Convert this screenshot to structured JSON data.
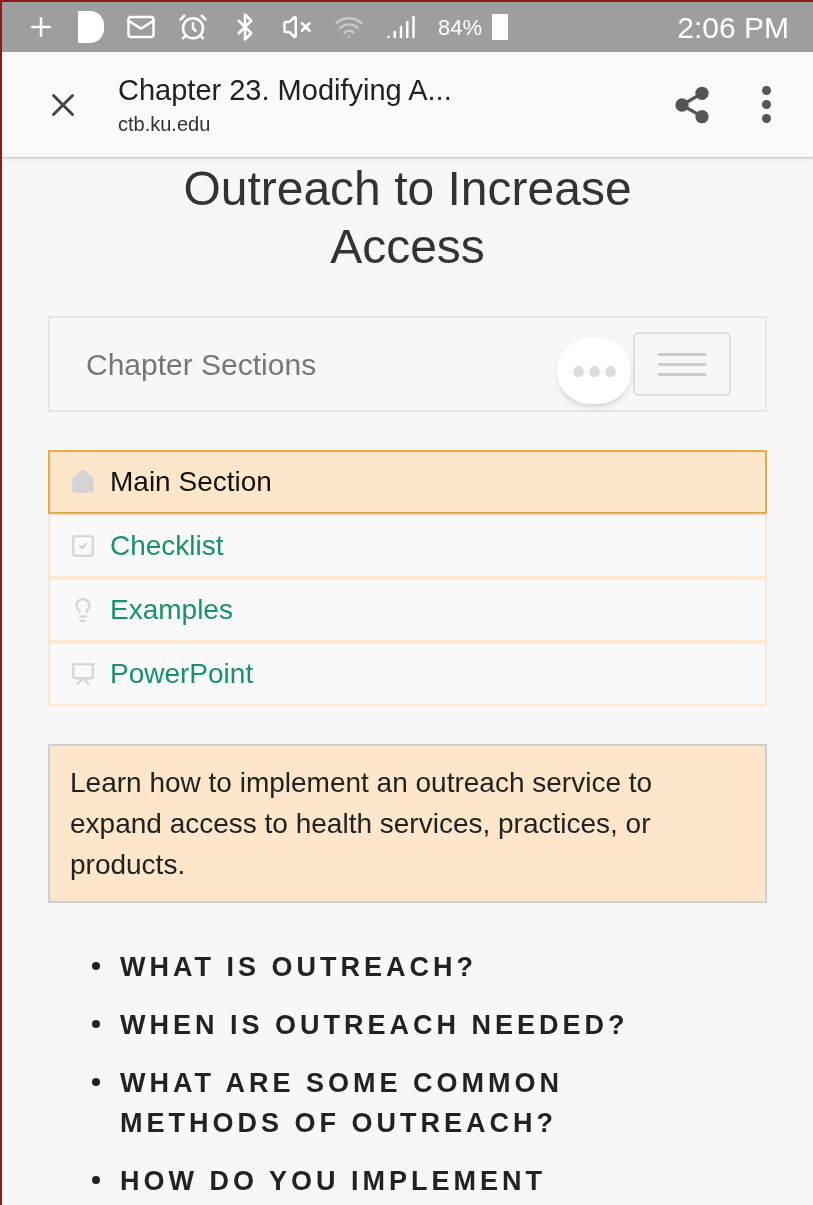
{
  "status_bar": {
    "battery": "84%",
    "time": "2:06 PM"
  },
  "browser_header": {
    "title": "Chapter 23. Modifying A...",
    "url": "ctb.ku.edu"
  },
  "page_title": "Outreach to Increase Access",
  "chapter_sections": {
    "label": "Chapter Sections"
  },
  "sections": [
    {
      "label": "Main Section",
      "kind": "home",
      "selected": true
    },
    {
      "label": "Checklist",
      "kind": "checklist",
      "selected": false
    },
    {
      "label": "Examples",
      "kind": "examples",
      "selected": false
    },
    {
      "label": "PowerPoint",
      "kind": "powerpoint",
      "selected": false
    }
  ],
  "summary": "Learn how to implement an outreach service to expand access to health services, practices, or products.",
  "topics": [
    "WHAT IS OUTREACH?",
    "WHEN IS OUTREACH NEEDED?",
    "WHAT ARE SOME COMMON METHODS OF OUTREACH?",
    "HOW DO YOU IMPLEMENT"
  ]
}
